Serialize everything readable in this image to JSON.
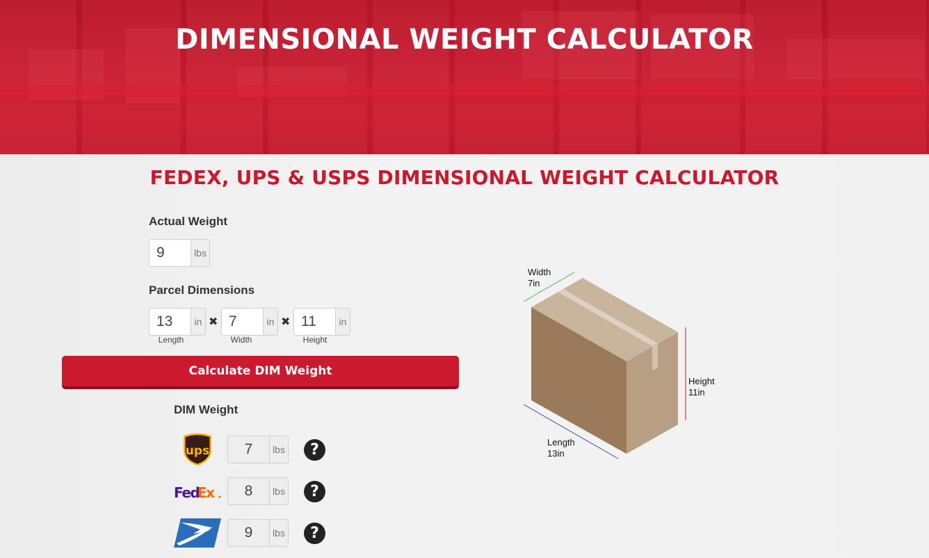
{
  "header": {
    "title": "DIMENSIONAL WEIGHT CALCULATOR"
  },
  "subtitle": "FEDEX, UPS & USPS DIMENSIONAL WEIGHT CALCULATOR",
  "form": {
    "actual_weight": {
      "label": "Actual Weight",
      "value": "9",
      "unit": "lbs"
    },
    "dimensions": {
      "label": "Parcel Dimensions",
      "separator_icon": "times-icon",
      "separator": "✖",
      "fields": [
        {
          "caption": "Length",
          "value": "13",
          "unit": "in"
        },
        {
          "caption": "Width",
          "value": "7",
          "unit": "in"
        },
        {
          "caption": "Height",
          "value": "11",
          "unit": "in"
        }
      ]
    },
    "calculate_label": "Calculate DIM Weight"
  },
  "results": {
    "label": "DIM Weight",
    "carriers": [
      {
        "name": "UPS",
        "logo_icon": "ups-logo",
        "value": "7",
        "unit": "lbs",
        "help_icon": "question-circle-icon",
        "help": "?"
      },
      {
        "name": "FedEx",
        "logo_icon": "fedex-logo",
        "value": "8",
        "unit": "lbs",
        "help_icon": "question-circle-icon",
        "help": "?"
      },
      {
        "name": "USPS",
        "logo_icon": "usps-logo",
        "value": "9",
        "unit": "lbs",
        "help_icon": "question-circle-icon",
        "help": "?"
      }
    ]
  },
  "diagram": {
    "width": {
      "label": "Width",
      "value": "7in",
      "color": "#4caf50"
    },
    "height": {
      "label": "Height",
      "value": "11in",
      "color": "#b22a2a"
    },
    "length": {
      "label": "Length",
      "value": "13in",
      "color": "#3a4fa8"
    }
  },
  "logos": {
    "fedex_fed": "Fed",
    "fedex_ex": "Ex",
    "ups_text": "ups"
  },
  "colors": {
    "brand_red": "#c8192d",
    "button_red": "#cb1a2d",
    "fedex_purple": "#4d148c",
    "fedex_orange": "#ff6600",
    "ups_brown": "#351c15",
    "ups_gold": "#ffb500",
    "usps_blue": "#2a6ebb"
  }
}
